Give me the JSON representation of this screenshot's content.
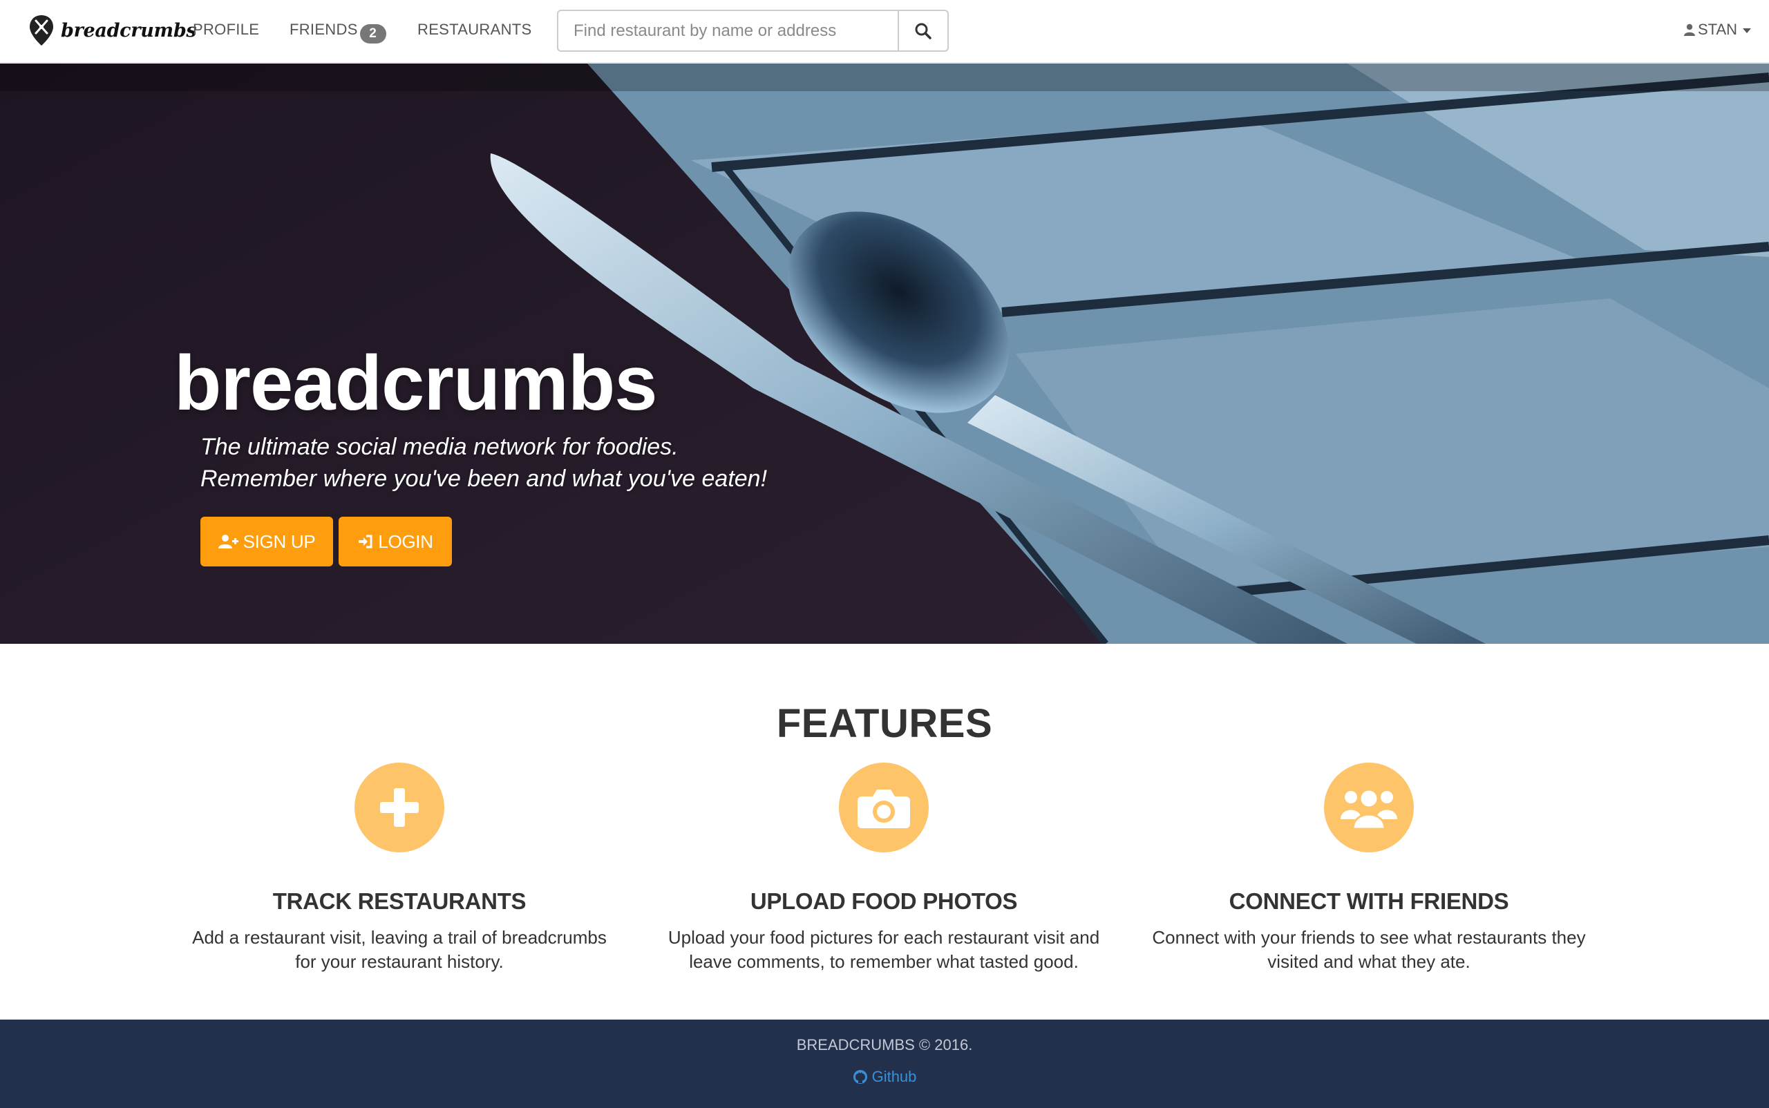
{
  "brand": {
    "name": "breadcrumbs",
    "icon": "map-pin-fork-knife-icon"
  },
  "nav": {
    "profile": "PROFILE",
    "friends": "FRIENDS",
    "friends_badge": "2",
    "restaurants": "RESTAURANTS"
  },
  "search": {
    "placeholder": "Find restaurant by name or address",
    "value": "",
    "icon": "search-icon"
  },
  "user": {
    "name": "STAN",
    "icon": "user-icon"
  },
  "hero": {
    "title": "breadcrumbs",
    "tagline_line1": "The ultimate social media network for foodies.",
    "tagline_line2": "Remember where you've been and what you've eaten!",
    "signup_label": "SIGN UP",
    "login_label": "LOGIN"
  },
  "features": {
    "title": "FEATURES",
    "items": [
      {
        "icon": "plus-icon",
        "title": "TRACK RESTAURANTS",
        "line1": "Add a restaurant visit, leaving a trail of breadcrumbs",
        "line2": "for your restaurant history."
      },
      {
        "icon": "camera-icon",
        "title": "UPLOAD FOOD PHOTOS",
        "line1": "Upload your food pictures for each restaurant visit and",
        "line2": "leave comments, to remember what tasted good."
      },
      {
        "icon": "users-icon",
        "title": "CONNECT WITH FRIENDS",
        "line1": "Connect with your friends to see what restaurants they",
        "line2": "visited and what they ate."
      }
    ]
  },
  "footer": {
    "copyright": "BREADCRUMBS © 2016.",
    "github": "Github"
  },
  "colors": {
    "accent": "#fe9e0f",
    "feature_icon_bg": "#fdc469",
    "footer_bg": "#22304c",
    "link": "#3a8fd8"
  }
}
